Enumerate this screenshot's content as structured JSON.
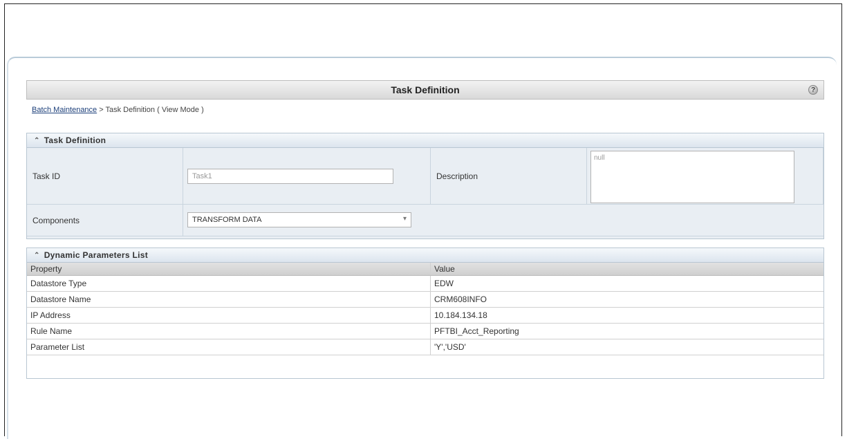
{
  "header": {
    "title": "Task Definition",
    "help_icon": "help-icon"
  },
  "breadcrumb": {
    "link": "Batch Maintenance",
    "rest": " > Task Definition ( View Mode )"
  },
  "task_section": {
    "title": "Task Definition",
    "task_id_label": "Task ID",
    "task_id_value": "Task1",
    "description_label": "Description",
    "description_value": "null",
    "components_label": "Components",
    "components_value": "TRANSFORM DATA"
  },
  "params_section": {
    "title": "Dynamic Parameters List",
    "columns": [
      "Property",
      "Value"
    ],
    "rows": [
      [
        "Datastore Type",
        "EDW"
      ],
      [
        "Datastore Name",
        "CRM608INFO"
      ],
      [
        "IP Address",
        "10.184.134.18"
      ],
      [
        "Rule Name",
        "PFTBI_Acct_Reporting"
      ],
      [
        "Parameter List",
        "'Y','USD'"
      ]
    ]
  }
}
